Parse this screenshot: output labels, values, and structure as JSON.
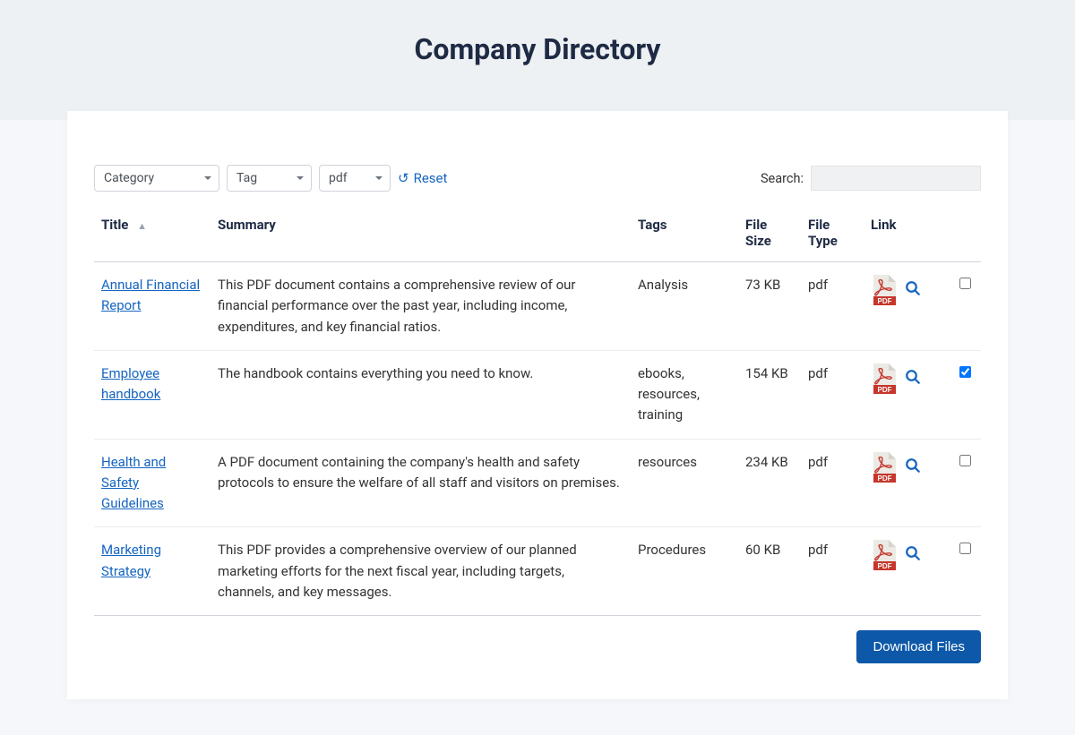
{
  "header": {
    "title": "Company Directory"
  },
  "filters": {
    "category_label": "Category",
    "tag_label": "Tag",
    "type_value": "pdf",
    "reset_label": "Reset"
  },
  "search": {
    "label": "Search:"
  },
  "columns": {
    "title": "Title",
    "summary": "Summary",
    "tags": "Tags",
    "size": "File Size",
    "type": "File Type",
    "link": "Link"
  },
  "rows": [
    {
      "title": "Annual Financial Report",
      "summary": "This PDF document contains a comprehensive review of our financial performance over the past year, including income, expenditures, and key financial ratios.",
      "tags": "Analysis",
      "size": "73 KB",
      "type": "pdf",
      "checked": false
    },
    {
      "title": "Employee handbook",
      "summary": "The handbook contains everything you need to know.",
      "tags": "ebooks, resources, training",
      "size": "154 KB",
      "type": "pdf",
      "checked": true
    },
    {
      "title": "Health and Safety Guidelines",
      "summary": "A PDF document containing the company's health and safety protocols to ensure the welfare of all staff and visitors on premises.",
      "tags": "resources",
      "size": "234 KB",
      "type": "pdf",
      "checked": false
    },
    {
      "title": "Marketing Strategy",
      "summary": "This PDF provides a comprehensive overview of our planned marketing efforts for the next fiscal year, including targets, channels, and key messages.",
      "tags": "Procedures",
      "size": "60 KB",
      "type": "pdf",
      "checked": false
    }
  ],
  "download_label": "Download Files"
}
